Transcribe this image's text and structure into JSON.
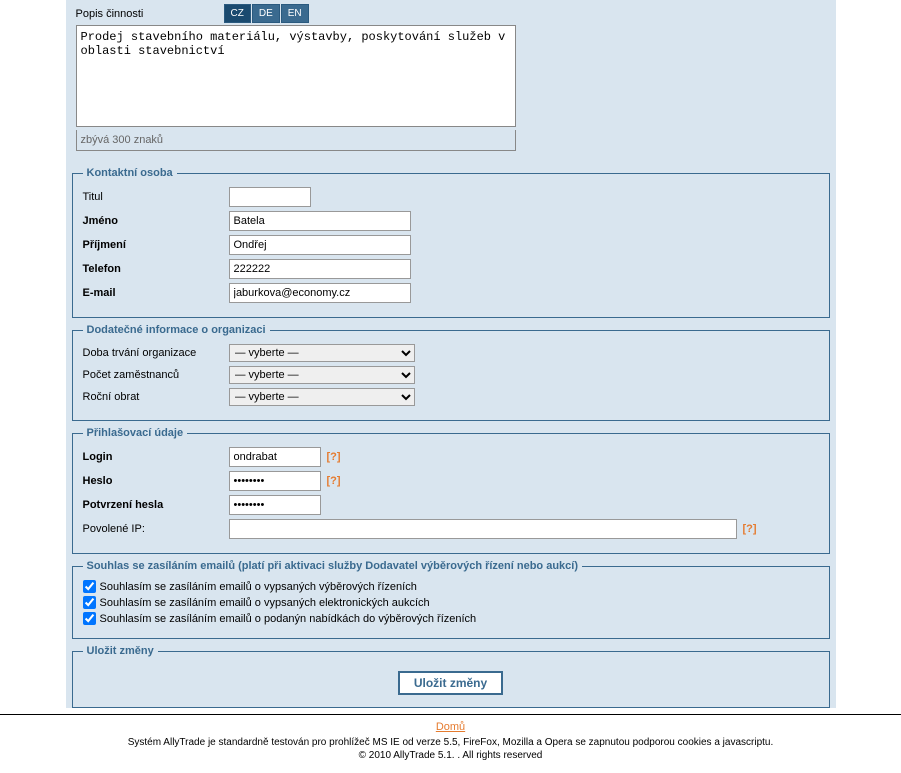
{
  "activity": {
    "label": "Popis činnosti",
    "tabs": {
      "cz": "CZ",
      "de": "DE",
      "en": "EN"
    },
    "text": "Prodej stavebního materiálu, výstavby, poskytování služeb v oblasti stavebnictví",
    "remaining": "zbývá 300 znaků"
  },
  "contact": {
    "legend": "Kontaktní osoba",
    "titul_lbl": "Titul",
    "titul_val": "",
    "jmeno_lbl": "Jméno",
    "jmeno_val": "Batela",
    "prijmeni_lbl": "Příjmení",
    "prijmeni_val": "Ondřej",
    "telefon_lbl": "Telefon",
    "telefon_val": "222222",
    "email_lbl": "E-mail",
    "email_val": "jaburkova@economy.cz"
  },
  "orginfo": {
    "legend": "Dodatečné informace o organizaci",
    "doba_lbl": "Doba trvání organizace",
    "pocet_lbl": "Počet zaměstnanců",
    "obrat_lbl": "Roční obrat",
    "placeholder": "— vyberte —"
  },
  "login": {
    "legend": "Přihlašovací údaje",
    "login_lbl": "Login",
    "login_val": "ondrabat",
    "heslo_lbl": "Heslo",
    "heslo_val": "••••••••",
    "potvrz_lbl": "Potvrzení hesla",
    "potvrz_val": "••••••••",
    "ip_lbl": "Povolené IP:",
    "ip_val": "",
    "help": "[?]"
  },
  "consent": {
    "legend": "Souhlas se zasíláním emailů (platí při aktivaci služby Dodavatel výběrových řízení nebo aukcí)",
    "c1": "Souhlasím se zasíláním emailů o vypsaných výběrových řízeních",
    "c2": "Souhlasím se zasíláním emailů o vypsaných elektronických aukcích",
    "c3": "Souhlasím se zasíláním emailů o podanýn nabídkách do výběrových řízeních"
  },
  "save": {
    "legend": "Uložit změny",
    "btn": "Uložit změny"
  },
  "footer": {
    "home": "Domů",
    "sys": "Systém AllyTrade je standardně testován pro prohlížeč MS IE od verze 5.5, FireFox, Mozilla a Opera se zapnutou podporou cookies a javascriptu.",
    "copy": "© 2010 AllyTrade 5.1. . All rights reserved"
  }
}
